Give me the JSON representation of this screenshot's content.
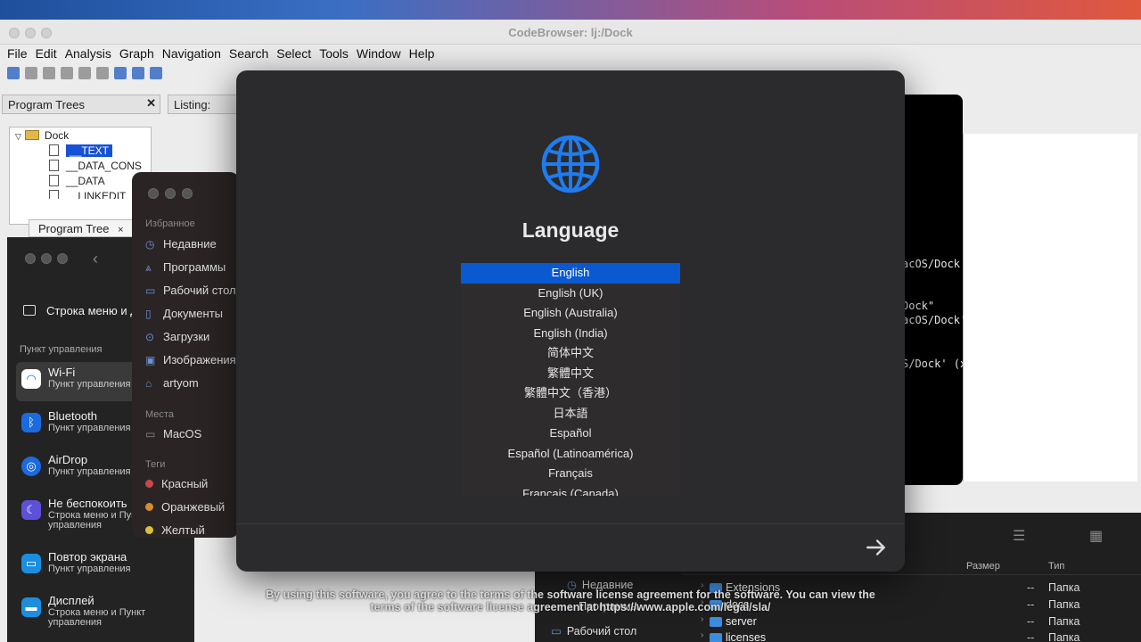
{
  "ghidra": {
    "title": "CodeBrowser: lj:/Dock",
    "menu": [
      "File",
      "Edit",
      "Analysis",
      "Graph",
      "Navigation",
      "Search",
      "Select",
      "Tools",
      "Window",
      "Help"
    ],
    "program_trees_label": "Program Trees",
    "listing_label": "Listing:",
    "tree_root": "Dock",
    "tree_items": [
      "__TEXT",
      "__DATA_CONS",
      "__DATA",
      "__LINKEDIT"
    ],
    "program_tree_tab": "Program Tree"
  },
  "terminal": {
    "lines": [
      "acOS/Dock",
      "Dock\"",
      "acOS/Dock'",
      "S/Dock' (x"
    ]
  },
  "settings": {
    "header": "Строка меню и Д",
    "section": "Пункт управления",
    "items": [
      {
        "title": "Wi-Fi",
        "sub": "Пункт управления"
      },
      {
        "title": "Bluetooth",
        "sub": "Пункт управления"
      },
      {
        "title": "AirDrop",
        "sub": "Пункт управления"
      },
      {
        "title": "Не беспокоить",
        "sub": "Строка меню и Пун",
        "sub2": "управления"
      },
      {
        "title": "Повтор экрана",
        "sub": "Пункт управления"
      },
      {
        "title": "Дисплей",
        "sub": "Строка меню и Пункт",
        "sub2": "управления"
      }
    ]
  },
  "finder": {
    "favorites_label": "Избранное",
    "favorites": [
      "Недавние",
      "Программы",
      "Рабочий стол",
      "Документы",
      "Загрузки",
      "Изображения",
      "artyom"
    ],
    "places_label": "Места",
    "places": [
      "MacOS"
    ],
    "tags_label": "Теги",
    "tags": [
      {
        "name": "Красный",
        "color": "#c8484a"
      },
      {
        "name": "Оранжевый",
        "color": "#d98a2b"
      },
      {
        "name": "Желтый",
        "color": "#d8c23a"
      }
    ]
  },
  "files": {
    "sidebar": [
      "Недавние",
      "Программы",
      "Рабочий стол"
    ],
    "col_size": "Размер",
    "col_kind": "Тип",
    "rows": [
      {
        "name": "Extensions",
        "size": "--",
        "kind": "Папка"
      },
      {
        "name": "docs",
        "size": "--",
        "kind": "Папка"
      },
      {
        "name": "server",
        "size": "--",
        "kind": "Папка"
      },
      {
        "name": "licenses",
        "size": "--",
        "kind": "Папка"
      }
    ]
  },
  "installer": {
    "title": "Language",
    "languages": [
      "English",
      "English (UK)",
      "English (Australia)",
      "English (India)",
      "简体中文",
      "繁體中文",
      "繁體中文（香港）",
      "日本語",
      "Español",
      "Español (Latinoamérica)",
      "Français",
      "Français (Canada)"
    ],
    "selected": "English",
    "accent": "#0a59d1",
    "next_icon": "arrow-right-icon",
    "license_text_1": "By using this software, you agree to the terms of the software license agreement for the software. You can view the",
    "license_text_2": "terms of the software license agreement at https://www.apple.com/legal/sla/"
  }
}
